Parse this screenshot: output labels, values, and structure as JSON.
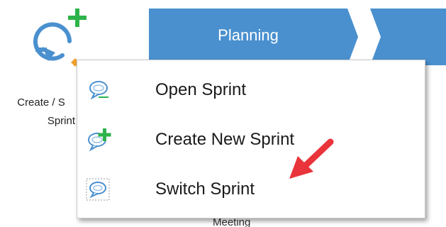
{
  "sprint_button": {
    "caption_line1": "Create / S",
    "caption_line2": "Sprint"
  },
  "process_bar": {
    "step_label": "Planning"
  },
  "partial_label": "Meeting",
  "menu": {
    "items": [
      {
        "label": "Open Sprint",
        "icon": "chat-bubble-icon"
      },
      {
        "label": "Create New Sprint",
        "icon": "chat-bubble-plus-icon"
      },
      {
        "label": "Switch Sprint",
        "icon": "chat-bubble-dashed-icon"
      }
    ]
  },
  "colors": {
    "accent_blue": "#4a90cf",
    "green_plus": "#2db34a",
    "orange_handle": "#f0a030",
    "annotation_red": "#e8343a"
  }
}
